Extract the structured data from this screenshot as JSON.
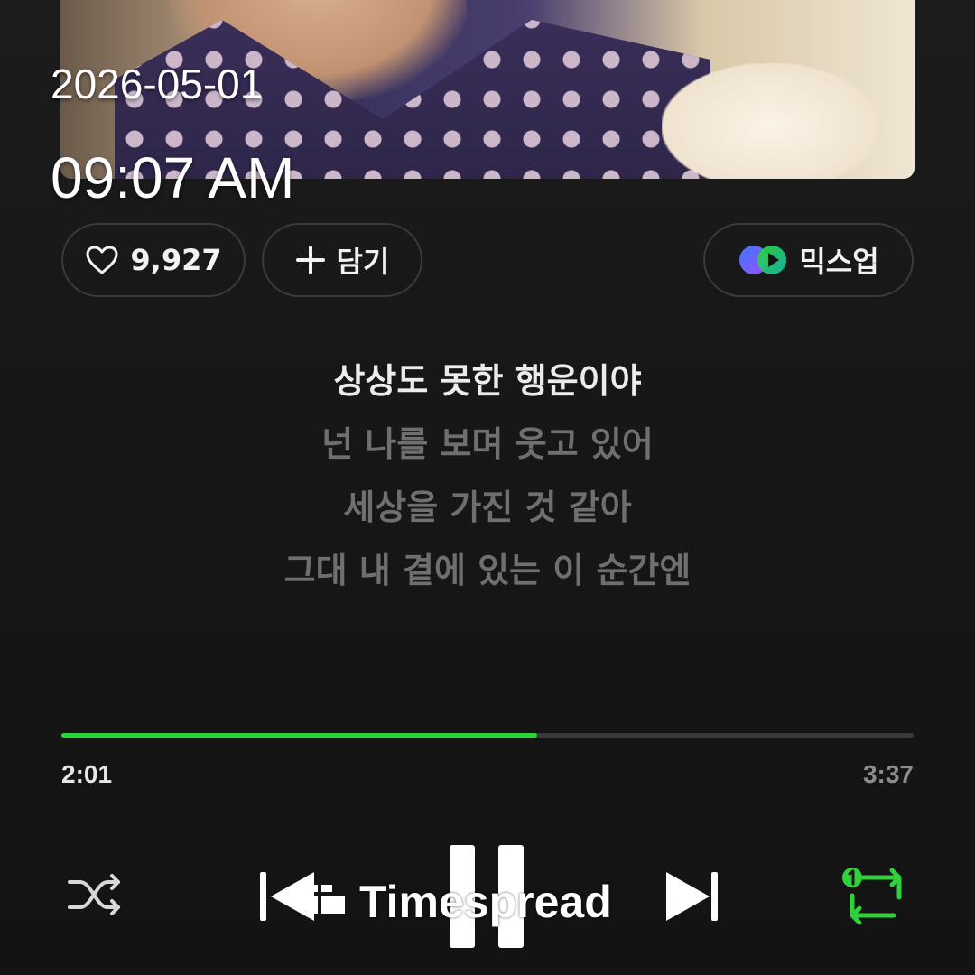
{
  "overlay": {
    "date": "2026-05-01",
    "time": "09:07 AM"
  },
  "actions": {
    "like_count": "9,927",
    "add_label": "담기",
    "mixup_label": "믹스업"
  },
  "lyrics": {
    "current": "상상도 못한 행운이야",
    "upcoming": [
      "넌 나를 보며 웃고 있어",
      "세상을 가진 것 같아",
      "그대 내 곁에 있는 이 순간엔"
    ]
  },
  "playback": {
    "elapsed": "2:01",
    "total": "3:37",
    "progress_fraction": 0.558
  },
  "watermark": {
    "text": "Timespread"
  },
  "colors": {
    "accent": "#2fd23a",
    "background": "#151515",
    "lyric_current": "#ececec",
    "lyric_dim": "#6f6f6f"
  },
  "icons": {
    "like": "heart-outline-icon",
    "add": "plus-icon",
    "mixup": "mixup-logo-icon",
    "shuffle": "shuffle-icon",
    "previous": "skip-previous-icon",
    "pause": "pause-icon",
    "next": "skip-next-icon",
    "repeat": "repeat-one-icon"
  }
}
